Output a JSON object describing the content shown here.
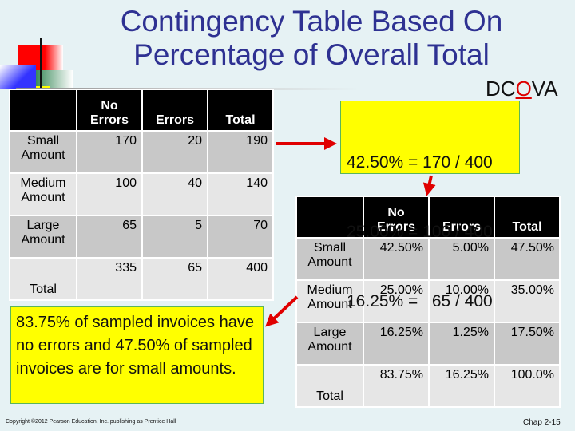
{
  "title": "Contingency Table Based On Percentage of Overall Total",
  "dcova": {
    "pre": "DC",
    "highlight": "O",
    "post": "VA"
  },
  "columns": [
    "No Errors",
    "Errors",
    "Total"
  ],
  "counts_table": {
    "rows": [
      {
        "label": "Small Amount",
        "values": [
          "170",
          "20",
          "190"
        ]
      },
      {
        "label": "Medium Amount",
        "values": [
          "100",
          "40",
          "140"
        ]
      },
      {
        "label": "Large Amount",
        "values": [
          "65",
          "5",
          "70"
        ]
      },
      {
        "label": "Total",
        "values": [
          "335",
          "65",
          "400"
        ]
      }
    ]
  },
  "percent_table": {
    "rows": [
      {
        "label": "Small Amount",
        "values": [
          "42.50%",
          "5.00%",
          "47.50%"
        ]
      },
      {
        "label": "Medium Amount",
        "values": [
          "25.00%",
          "10.00%",
          "35.00%"
        ]
      },
      {
        "label": "Large Amount",
        "values": [
          "16.25%",
          "1.25%",
          "17.50%"
        ]
      },
      {
        "label": "Total",
        "values": [
          "83.75%",
          "16.25%",
          "100.0%"
        ]
      }
    ]
  },
  "calc_box": [
    "42.50% = 170 / 400",
    "25.00% = 100 / 400",
    "16.25% =   65 / 400"
  ],
  "note_box": "83.75% of sampled invoices have no errors and 47.50% of sampled invoices are for small amounts.",
  "footer": {
    "copyright": "Copyright ©2012 Pearson Education, Inc. publishing as Prentice Hall",
    "page": "Chap 2-15"
  },
  "colors": {
    "title": "#2e3192",
    "highlight_box": "#ffff00",
    "arrow": "#e00000",
    "header": "#000000"
  }
}
